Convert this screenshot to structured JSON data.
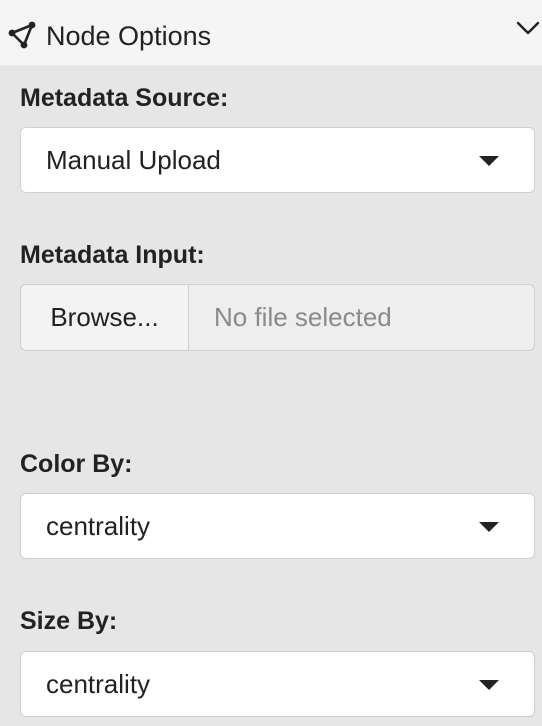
{
  "header": {
    "title": "Node Options",
    "icon": "network-node-icon",
    "toggle_icon": "chevron-down-icon"
  },
  "metadata_source": {
    "label": "Metadata Source:",
    "selected": "Manual Upload"
  },
  "metadata_input": {
    "label": "Metadata Input:",
    "browse_label": "Browse...",
    "file_placeholder": "No file selected"
  },
  "color_by": {
    "label": "Color By:",
    "selected": "centrality"
  },
  "size_by": {
    "label": "Size By:",
    "selected": "centrality"
  }
}
